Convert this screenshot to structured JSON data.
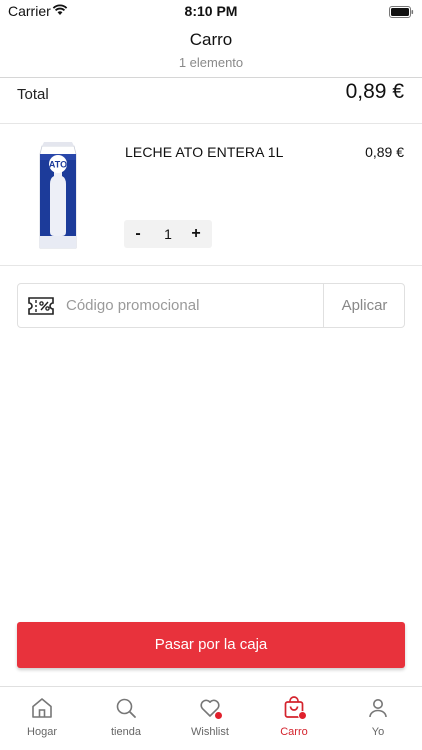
{
  "status_bar": {
    "carrier": "Carrier",
    "time": "8:10 PM"
  },
  "header": {
    "title": "Carro",
    "subtitle": "1 elemento"
  },
  "summary": {
    "total_label": "Total",
    "total_value": "0,89 €"
  },
  "cart": {
    "items": [
      {
        "name": "LECHE ATO ENTERA 1L",
        "price": "0,89 €",
        "quantity": "1",
        "image_brand": "ATO"
      }
    ]
  },
  "promo": {
    "placeholder": "Código promocional",
    "value": "",
    "apply_label": "Aplicar"
  },
  "checkout": {
    "label": "Pasar por la caja"
  },
  "tabs": [
    {
      "label": "Hogar",
      "icon": "home-icon",
      "active": false,
      "badge": false
    },
    {
      "label": "tienda",
      "icon": "search-icon",
      "active": false,
      "badge": false
    },
    {
      "label": "Wishlist",
      "icon": "heart-icon",
      "active": false,
      "badge": true
    },
    {
      "label": "Carro",
      "icon": "shopping-bag-icon",
      "active": true,
      "badge": true
    },
    {
      "label": "Yo",
      "icon": "user-icon",
      "active": false,
      "badge": false
    }
  ],
  "colors": {
    "accent": "#e8323c",
    "active_tab": "#d4232d",
    "badge": "#e0202c"
  }
}
